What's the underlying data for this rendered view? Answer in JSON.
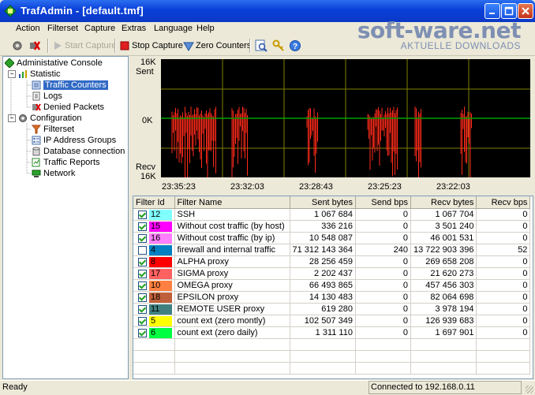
{
  "window": {
    "title": "TrafAdmin - [default.tmf]"
  },
  "menu": [
    "Action",
    "Filterset",
    "Capture",
    "Extras",
    "Language",
    "Help"
  ],
  "toolbar": {
    "start_capture": "Start Capture",
    "stop_capture": "Stop Capture",
    "zero_counters": "Zero Counters"
  },
  "watermark": {
    "line1": "soft-ware.net",
    "line2": "AKTUELLE DOWNLOADS"
  },
  "tree": {
    "root": "Administative Console",
    "statistic": "Statistic",
    "traffic_counters": "Traffic Counters",
    "logs": "Logs",
    "denied_packets": "Denied Packets",
    "configuration": "Configuration",
    "filterset": "Filterset",
    "ip_groups": "IP Address Groups",
    "db_connection": "Database connection",
    "traffic_reports": "Traffic Reports",
    "network": "Network"
  },
  "chart": {
    "y_top": "16K",
    "y_top_label": "Sent",
    "y_mid": "0K",
    "y_bottom_label": "Recv",
    "y_bottom": "16K",
    "x_ticks": [
      "23:35:23",
      "23:32:03",
      "23:28:43",
      "23:25:23",
      "23:22:03"
    ],
    "colors": {
      "background": "#000000",
      "grid": "#808000",
      "zero_line": "#00a000",
      "traffic": "#ff2a1a"
    }
  },
  "table": {
    "headers": [
      "Filter Id",
      "Filter Name",
      "Sent bytes",
      "Send bps",
      "Recv bytes",
      "Recv bps"
    ],
    "rows": [
      {
        "checked": true,
        "id": "12",
        "color": "#80ffff",
        "name": "SSH",
        "sent": "1 067 684",
        "send_bps": "0",
        "recv": "1 067 704",
        "recv_bps": "0"
      },
      {
        "checked": true,
        "id": "15",
        "color": "#ff00ff",
        "name": "Without cost traffic (by host)",
        "sent": "336 216",
        "send_bps": "0",
        "recv": "3 501 240",
        "recv_bps": "0"
      },
      {
        "checked": true,
        "id": "16",
        "color": "#ff80ff",
        "name": "Without cost traffic (by ip)",
        "sent": "10 548 087",
        "send_bps": "0",
        "recv": "46 001 531",
        "recv_bps": "0"
      },
      {
        "checked": false,
        "id": "4",
        "color": "#0080c0",
        "name": "firewall and internal traffic",
        "sent": "71 312 143 364",
        "send_bps": "240",
        "recv": "13 722 903 396",
        "recv_bps": "52"
      },
      {
        "checked": true,
        "id": "8",
        "color": "#ff0000",
        "name": "ALPHA proxy",
        "sent": "28 256 459",
        "send_bps": "0",
        "recv": "269 658 208",
        "recv_bps": "0"
      },
      {
        "checked": true,
        "id": "17",
        "color": "#ff6060",
        "name": "SIGMA proxy",
        "sent": "2 202 437",
        "send_bps": "0",
        "recv": "21 620 273",
        "recv_bps": "0"
      },
      {
        "checked": true,
        "id": "10",
        "color": "#ff8040",
        "name": "OMEGA proxy",
        "sent": "66 493 865",
        "send_bps": "0",
        "recv": "457 456 303",
        "recv_bps": "0"
      },
      {
        "checked": true,
        "id": "18",
        "color": "#c0603a",
        "name": "EPSILON proxy",
        "sent": "14 130 483",
        "send_bps": "0",
        "recv": "82 064 698",
        "recv_bps": "0"
      },
      {
        "checked": true,
        "id": "11",
        "color": "#408080",
        "name": "REMOTE USER proxy",
        "sent": "619 280",
        "send_bps": "0",
        "recv": "3 978 194",
        "recv_bps": "0"
      },
      {
        "checked": true,
        "id": "5",
        "color": "#ffff00",
        "name": "count ext (zero montly)",
        "sent": "102 507 349",
        "send_bps": "0",
        "recv": "126 939 683",
        "recv_bps": "0"
      },
      {
        "checked": true,
        "id": "6",
        "color": "#00ff40",
        "name": "count ext (zero daily)",
        "sent": "1 311 110",
        "send_bps": "0",
        "recv": "1 697 901",
        "recv_bps": "0"
      }
    ]
  },
  "status": {
    "left": "Ready",
    "right": "Connected to 192.168.0.11"
  }
}
